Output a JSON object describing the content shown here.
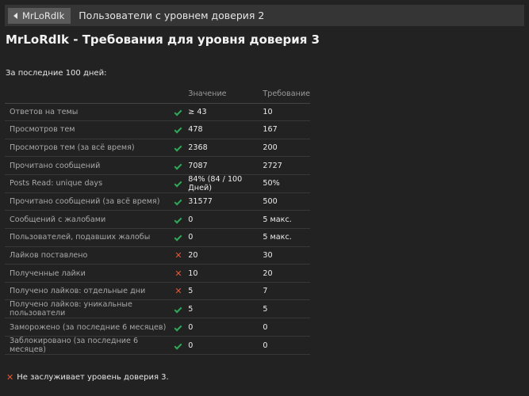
{
  "header": {
    "back_label": "MrLoRdIk",
    "title": "Пользователи с уровнем доверия 2"
  },
  "page_title": "MrLoRdIk - Требования для уровня доверия 3",
  "period": "За последние 100 дней:",
  "columns": {
    "value": "Значение",
    "requirement": "Требование"
  },
  "rows": [
    {
      "label": "Ответов на темы",
      "met": true,
      "value": "≥ 43",
      "req": "10"
    },
    {
      "label": "Просмотров тем",
      "met": true,
      "value": "478",
      "req": "167"
    },
    {
      "label": "Просмотров тем (за всё время)",
      "met": true,
      "value": "2368",
      "req": "200"
    },
    {
      "label": "Прочитано сообщений",
      "met": true,
      "value": "7087",
      "req": "2727"
    },
    {
      "label": "Posts Read: unique days",
      "met": true,
      "value": "84% (84 / 100 Дней)",
      "req": "50%"
    },
    {
      "label": "Прочитано сообщений (за всё время)",
      "met": true,
      "value": "31577",
      "req": "500"
    },
    {
      "label": "Сообщений с жалобами",
      "met": true,
      "value": "0",
      "req": "5 макс."
    },
    {
      "label": "Пользователей, подавших жалобы",
      "met": true,
      "value": "0",
      "req": "5 макс."
    },
    {
      "label": "Лайков поставлено",
      "met": false,
      "value": "20",
      "req": "30"
    },
    {
      "label": "Полученные лайки",
      "met": false,
      "value": "10",
      "req": "20"
    },
    {
      "label": "Получено лайков: отдельные дни",
      "met": false,
      "value": "5",
      "req": "7"
    },
    {
      "label": "Получено лайков: уникальные пользователи",
      "met": true,
      "value": "5",
      "req": "5"
    },
    {
      "label": "Заморожено (за последние 6 месяцев)",
      "met": true,
      "value": "0",
      "req": "0"
    },
    {
      "label": "Заблокировано (за последние 6 месяцев)",
      "met": true,
      "value": "0",
      "req": "0"
    }
  ],
  "result": "Не заслуживает уровень доверия 3.",
  "icons": {
    "met": "check-icon",
    "not_met": "cross-icon"
  },
  "colors": {
    "met": "#2fa858",
    "not_met": "#e45735"
  }
}
